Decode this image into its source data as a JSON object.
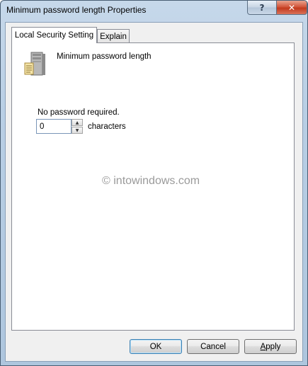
{
  "window": {
    "title": "Minimum password length Properties",
    "help_label": "?",
    "close_label": "✕"
  },
  "tabs": [
    {
      "label": "Local Security Setting",
      "active": true
    },
    {
      "label": "Explain",
      "active": false
    }
  ],
  "policy": {
    "icon": "server-computer-icon",
    "name": "Minimum password length"
  },
  "setting": {
    "hint": "No password required.",
    "value": "0",
    "unit": "characters",
    "spin_up": "▲",
    "spin_down": "▼"
  },
  "watermark": "© intowindows.com",
  "buttons": {
    "ok": "OK",
    "cancel": "Cancel",
    "apply_mnemonic": "A",
    "apply_rest": "pply"
  }
}
